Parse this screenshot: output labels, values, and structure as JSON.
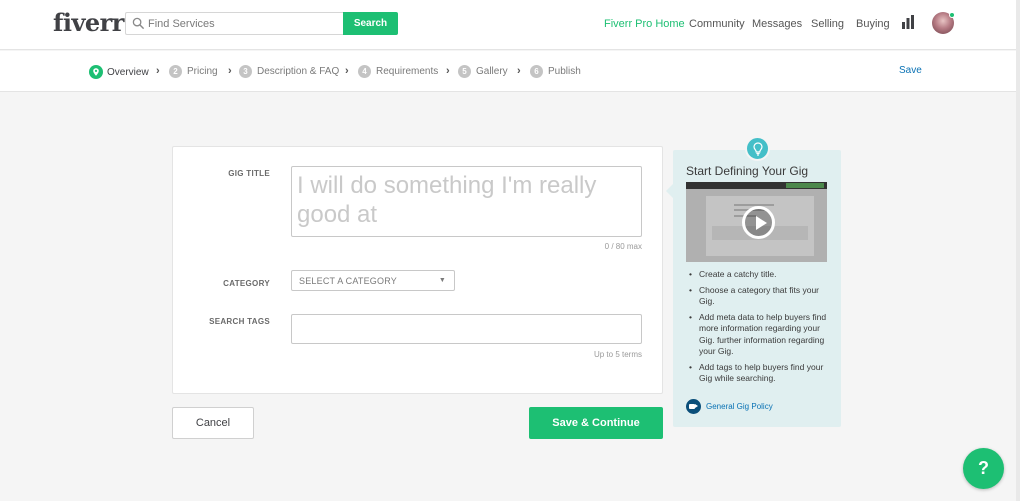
{
  "header": {
    "logo": "fiverr",
    "search_placeholder": "Find Services",
    "search_button": "Search",
    "nav": {
      "pro": "Fiverr Pro Home",
      "community": "Community",
      "messages": "Messages",
      "selling": "Selling",
      "buying": "Buying"
    }
  },
  "steps": [
    {
      "num": "",
      "label": "Overview",
      "active": true
    },
    {
      "num": "2",
      "label": "Pricing"
    },
    {
      "num": "3",
      "label": "Description & FAQ"
    },
    {
      "num": "4",
      "label": "Requirements"
    },
    {
      "num": "5",
      "label": "Gallery"
    },
    {
      "num": "6",
      "label": "Publish"
    }
  ],
  "step_save": "Save",
  "form": {
    "gig_title_label": "GIG TITLE",
    "gig_title_placeholder": "I will do something I'm really good at",
    "gig_title_counter": "0 / 80 max",
    "category_label": "CATEGORY",
    "category_value": "SELECT A CATEGORY",
    "search_tags_label": "SEARCH TAGS",
    "search_tags_hint": "Up to 5 terms"
  },
  "buttons": {
    "cancel": "Cancel",
    "save_continue": "Save & Continue"
  },
  "tips": {
    "title": "Start Defining Your Gig",
    "items": [
      "Create a catchy title.",
      "Choose a category that fits your Gig.",
      "Add meta data to help buyers find more information regarding your Gig. further information regarding your Gig.",
      "Add tags to help buyers find your Gig while searching."
    ],
    "policy_link": "General Gig Policy"
  },
  "help_button": "?",
  "colors": {
    "brand_green": "#1dbf73",
    "link_blue": "#0a72b4",
    "tips_bg": "#e0eff0",
    "bulb_teal": "#44bfc8"
  }
}
